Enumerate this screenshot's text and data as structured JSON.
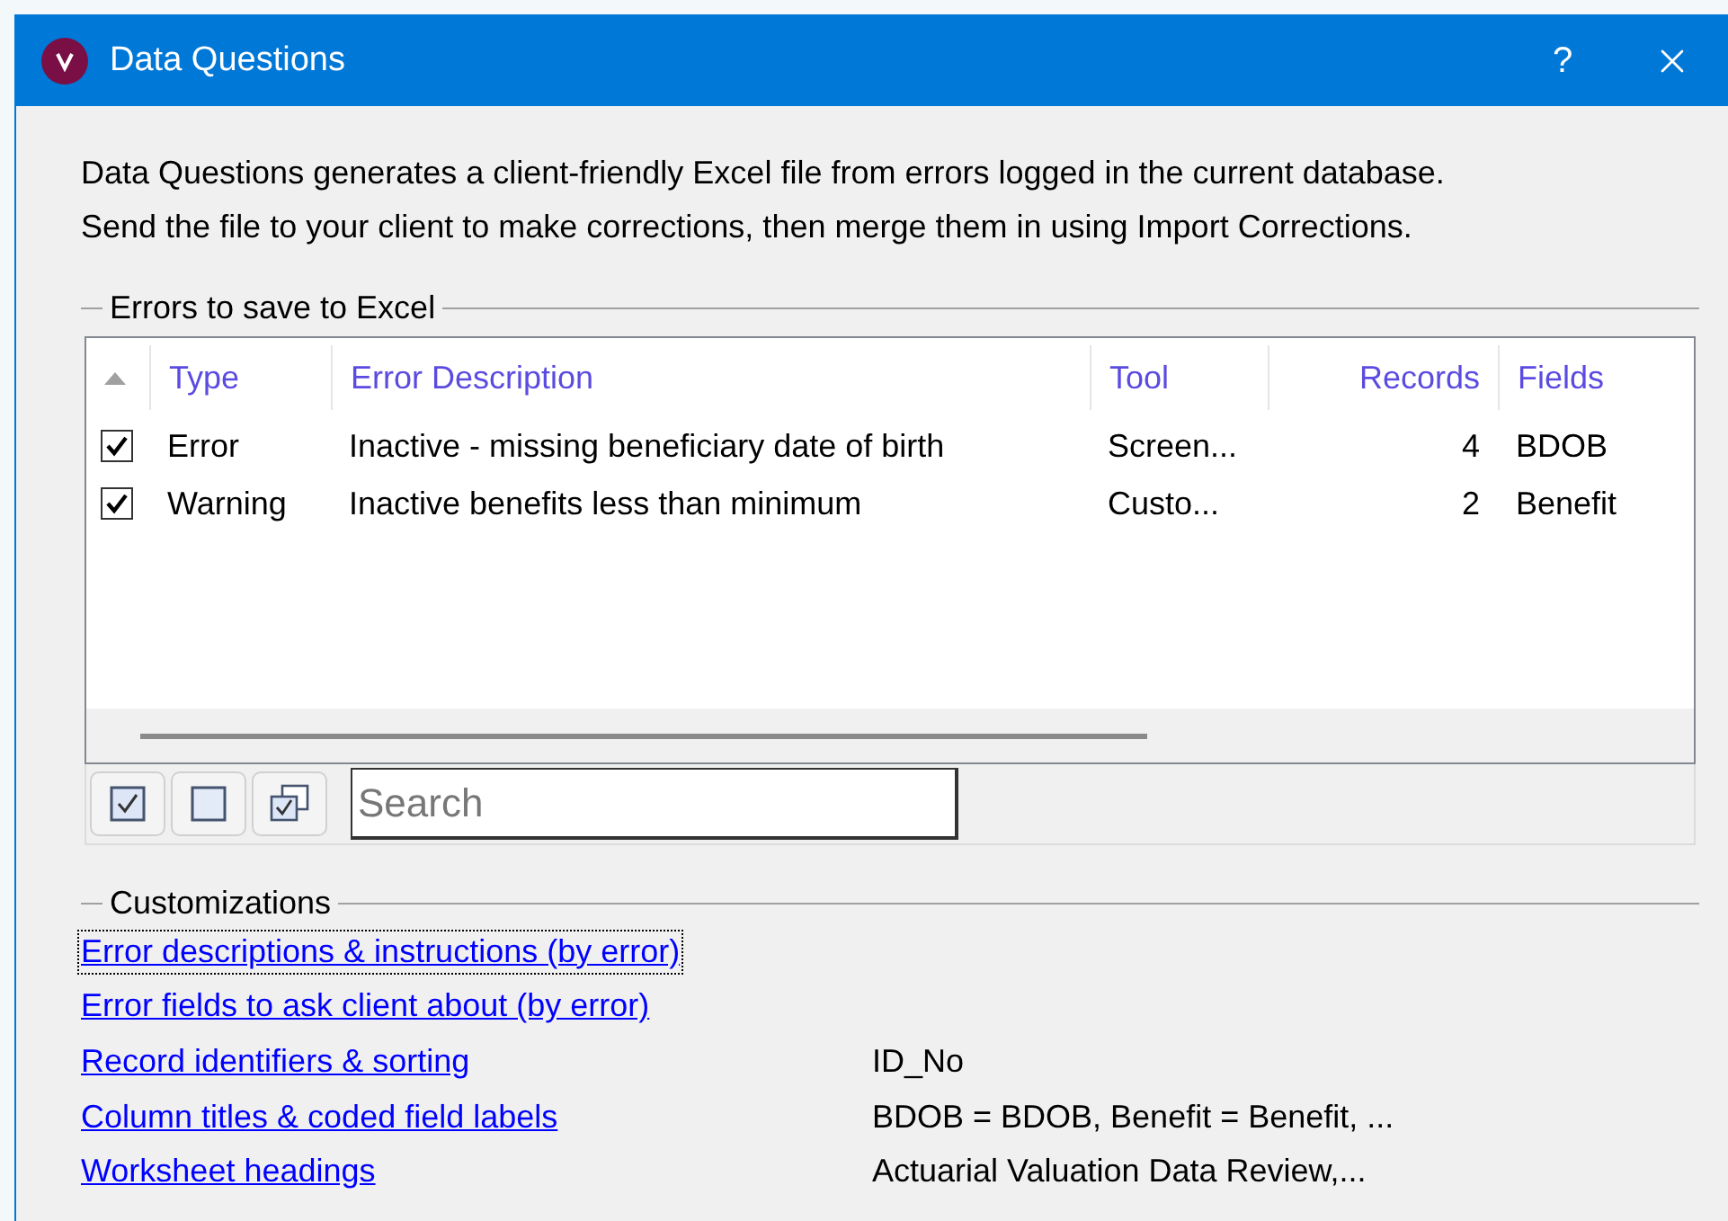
{
  "window": {
    "title": "Data Questions",
    "help": "?"
  },
  "description": [
    "Data Questions generates a client-friendly Excel file from errors logged in the current database.",
    "Send the file to your client to make corrections, then merge them in using Import Corrections."
  ],
  "errors_group": {
    "title": "Errors to save to Excel",
    "columns": [
      "Type",
      "Error Description",
      "Tool",
      "Records",
      "Fields"
    ],
    "rows": [
      {
        "checked": true,
        "cells": [
          "Error",
          "Inactive - missing beneficiary date of birth",
          "Screen...",
          "4",
          "BDOB"
        ]
      },
      {
        "checked": true,
        "cells": [
          "Warning",
          "Inactive benefits less than minimum",
          "Custo...",
          "2",
          "Benefit"
        ]
      }
    ],
    "search": {
      "placeholder": "Search"
    }
  },
  "customizations": {
    "title": "Customizations",
    "items": [
      {
        "link": "Error descriptions & instructions (by error)",
        "focused": true
      },
      {
        "link": "Error fields to ask client about (by error)",
        "focused": false
      },
      {
        "link": "Record identifiers & sorting",
        "focused": false,
        "value": "ID_No"
      },
      {
        "link": "Column titles & coded field labels",
        "focused": false,
        "value": "BDOB = BDOB, Benefit = Benefit, ..."
      },
      {
        "link": "Worksheet headings",
        "focused": false,
        "value": "Actuarial Valuation Data Review,..."
      }
    ]
  }
}
